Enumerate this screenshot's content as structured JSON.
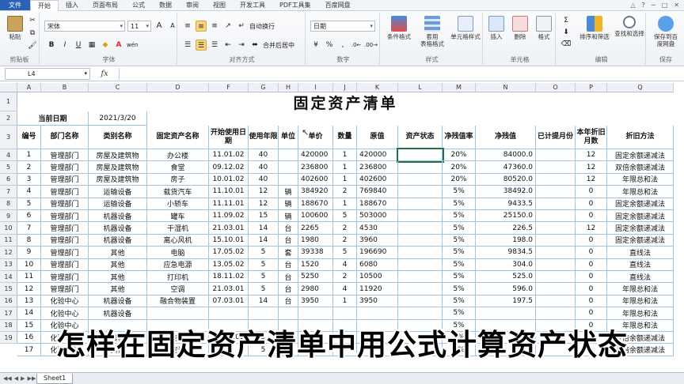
{
  "tabs": [
    "文件",
    "开始",
    "插入",
    "页面布局",
    "公式",
    "数据",
    "审阅",
    "视图",
    "开发工具",
    "PDF工具集",
    "百度网盘"
  ],
  "active_tab": "开始",
  "window_controls": [
    "△",
    "?",
    "─",
    "□",
    "✕"
  ],
  "ribbon": {
    "clipboard": {
      "paste": "粘贴",
      "label": "剪贴板"
    },
    "font": {
      "name": "宋体",
      "size": "11",
      "bold": "B",
      "italic": "I",
      "underline": "U",
      "grow": "A",
      "shrink": "A",
      "wen": "wén",
      "label": "字体"
    },
    "alignment": {
      "wrap": "自动换行",
      "merge": "合并后居中",
      "label": "对齐方式"
    },
    "number": {
      "format": "日期",
      "currency": "¥",
      "percent": "%",
      "comma": ",",
      "label": "数字"
    },
    "styles": {
      "conditional": "条件格式",
      "table1": "套用",
      "table2": "表格格式",
      "cell": "单元格样式",
      "label": "样式"
    },
    "cells": {
      "insert": "插入",
      "delete": "删除",
      "format": "格式",
      "label": "单元格"
    },
    "editing": {
      "sort": "排序和筛选",
      "find": "查找和选择",
      "label": "编辑"
    },
    "save": {
      "line1": "保存到百",
      "line2": "度网盘",
      "label": "保存"
    }
  },
  "formula_bar": {
    "name_box": "L4",
    "fx": "fx",
    "formula": ""
  },
  "columns": [
    "A",
    "B",
    "C",
    "D",
    "F",
    "G",
    "H",
    "I",
    "J",
    "K",
    "L",
    "M",
    "N",
    "O",
    "P",
    "Q"
  ],
  "row_numbers": [
    "1",
    "2",
    "3",
    "4",
    "5",
    "6",
    "7",
    "8",
    "9",
    "10",
    "11",
    "12",
    "13",
    "14",
    "15",
    "16",
    "17",
    "18",
    "19"
  ],
  "sheet_title": "固定资产清单",
  "current_date_label": "当前日期",
  "current_date_value": "2021/3/20",
  "table_headers": [
    "编号",
    "部门名称",
    "类别名称",
    "固定资产名称",
    "开始使用日期",
    "使用年限",
    "单位",
    "单价",
    "数量",
    "原值",
    "资产状态",
    "净残值率",
    "净残值",
    "已计提月份",
    "本年折旧月数",
    "折旧方法"
  ],
  "rows": [
    [
      "1",
      "管理部门",
      "房屋及建筑物",
      "办公楼",
      "11.01.02",
      "40",
      "",
      "420000",
      "1",
      "420000",
      "",
      "20%",
      "84000.0",
      "",
      "12",
      "固定余额递减法"
    ],
    [
      "2",
      "管理部门",
      "房屋及建筑物",
      "食堂",
      "09.12.02",
      "40",
      "",
      "236800",
      "1",
      "236800",
      "",
      "20%",
      "47360.0",
      "",
      "12",
      "双倍余额递减法"
    ],
    [
      "3",
      "管理部门",
      "房屋及建筑物",
      "房子",
      "10.01.02",
      "40",
      "",
      "402600",
      "1",
      "402600",
      "",
      "20%",
      "80520.0",
      "",
      "12",
      "年限总和法"
    ],
    [
      "4",
      "管理部门",
      "运输设备",
      "载货汽车",
      "11.10.01",
      "12",
      "辆",
      "384920",
      "2",
      "769840",
      "",
      "5%",
      "38492.0",
      "",
      "0",
      "年限总和法"
    ],
    [
      "5",
      "管理部门",
      "运输设备",
      "小轿车",
      "11.11.01",
      "12",
      "辆",
      "188670",
      "1",
      "188670",
      "",
      "5%",
      "9433.5",
      "",
      "0",
      "固定余额递减法"
    ],
    [
      "6",
      "管理部门",
      "机器设备",
      "罐车",
      "11.09.02",
      "15",
      "辆",
      "100600",
      "5",
      "503000",
      "",
      "5%",
      "25150.0",
      "",
      "0",
      "固定余额递减法"
    ],
    [
      "7",
      "管理部门",
      "机器设备",
      "干湿机",
      "21.03.01",
      "14",
      "台",
      "2265",
      "2",
      "4530",
      "",
      "5%",
      "226.5",
      "",
      "12",
      "固定余额递减法"
    ],
    [
      "8",
      "管理部门",
      "机器设备",
      "离心风机",
      "15.10.01",
      "14",
      "台",
      "1980",
      "2",
      "3960",
      "",
      "5%",
      "198.0",
      "",
      "0",
      "固定余额递减法"
    ],
    [
      "9",
      "管理部门",
      "其他",
      "电脑",
      "17.05.02",
      "5",
      "套",
      "39338",
      "5",
      "196690",
      "",
      "5%",
      "9834.5",
      "",
      "0",
      "直线法"
    ],
    [
      "10",
      "管理部门",
      "其他",
      "应急电源",
      "13.05.02",
      "5",
      "台",
      "1520",
      "4",
      "6080",
      "",
      "5%",
      "304.0",
      "",
      "0",
      "直线法"
    ],
    [
      "11",
      "管理部门",
      "其他",
      "打印机",
      "18.11.02",
      "5",
      "台",
      "5250",
      "2",
      "10500",
      "",
      "5%",
      "525.0",
      "",
      "0",
      "直线法"
    ],
    [
      "12",
      "管理部门",
      "其他",
      "空调",
      "21.03.01",
      "5",
      "台",
      "2980",
      "4",
      "11920",
      "",
      "5%",
      "596.0",
      "",
      "0",
      "年限总和法"
    ],
    [
      "13",
      "化验中心",
      "机器设备",
      "融合物装置",
      "07.03.01",
      "14",
      "台",
      "3950",
      "1",
      "3950",
      "",
      "5%",
      "197.5",
      "",
      "0",
      "年限总和法"
    ],
    [
      "14",
      "化验中心",
      "机器设备",
      "",
      "",
      "",
      "",
      "",
      "",
      "",
      "",
      "5%",
      "",
      "",
      "0",
      "年限总和法"
    ],
    [
      "15",
      "化验中心",
      "",
      "",
      "",
      "",
      "",
      "",
      "",
      "",
      "",
      "5%",
      "",
      "",
      "0",
      "年限总和法"
    ],
    [
      "16",
      "化验中心",
      "其他",
      "暖空调机",
      "15.09.01",
      "5",
      "台",
      "8236",
      "2",
      "16472",
      "",
      "5%",
      "823.6",
      "",
      "0",
      "双倍余额递减法"
    ],
    [
      "17",
      "化验中心",
      "其他",
      "空调",
      "",
      "5",
      "套",
      "6000",
      "",
      "",
      "",
      "5%",
      "",
      "",
      "",
      "双倍余额递减法"
    ]
  ],
  "caption": "怎样在固定资产清单中用公式计算资产状态",
  "sheet_tab": "Sheet1"
}
